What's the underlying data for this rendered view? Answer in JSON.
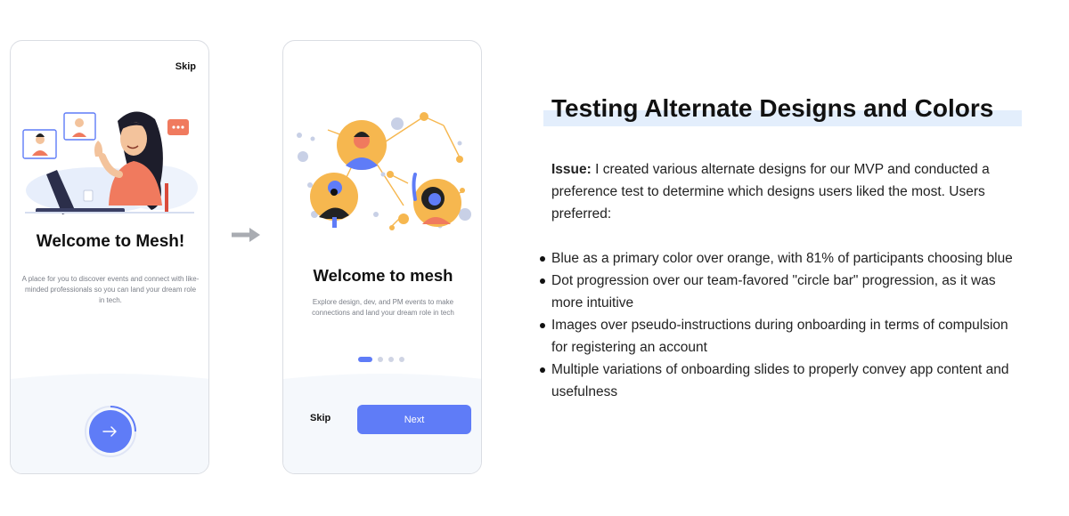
{
  "screens": [
    {
      "skip_label": "Skip",
      "title": "Welcome to Mesh!",
      "description": "A place for you to discover events and connect with like-minded professionals so you can land your dream role in tech.",
      "next_icon": "arrow-right-icon"
    },
    {
      "title": "Welcome to mesh",
      "description": "Explore design, dev, and PM events to make connections and land your dream role in tech",
      "pagination": {
        "total": 4,
        "current": 1
      },
      "skip_label": "Skip",
      "next_label": "Next"
    }
  ],
  "transition_icon": "arrow-right-icon",
  "section": {
    "heading": "Testing Alternate Designs and Colors",
    "issue_label": "Issue:",
    "issue_text": " I created various alternate designs for our MVP and conducted a preference test to determine which designs users liked the most. Users preferred:",
    "findings": [
      "Blue as a primary color over orange, with 81% of participants choosing blue",
      "Dot progression over our team-favored \"circle bar\" progression, as it was more intuitive",
      "Images over pseudo-instructions during onboarding in terms of compulsion for registering an account",
      "Multiple variations of onboarding slides to properly convey app content and usefulness"
    ]
  },
  "colors": {
    "primary": "#5f7cf7",
    "heading_highlight": "#e3eefc",
    "illustration_orange": "#f6b74f",
    "illustration_blue": "#5f7cf7",
    "bottom_panel": "#f5f8fc"
  }
}
